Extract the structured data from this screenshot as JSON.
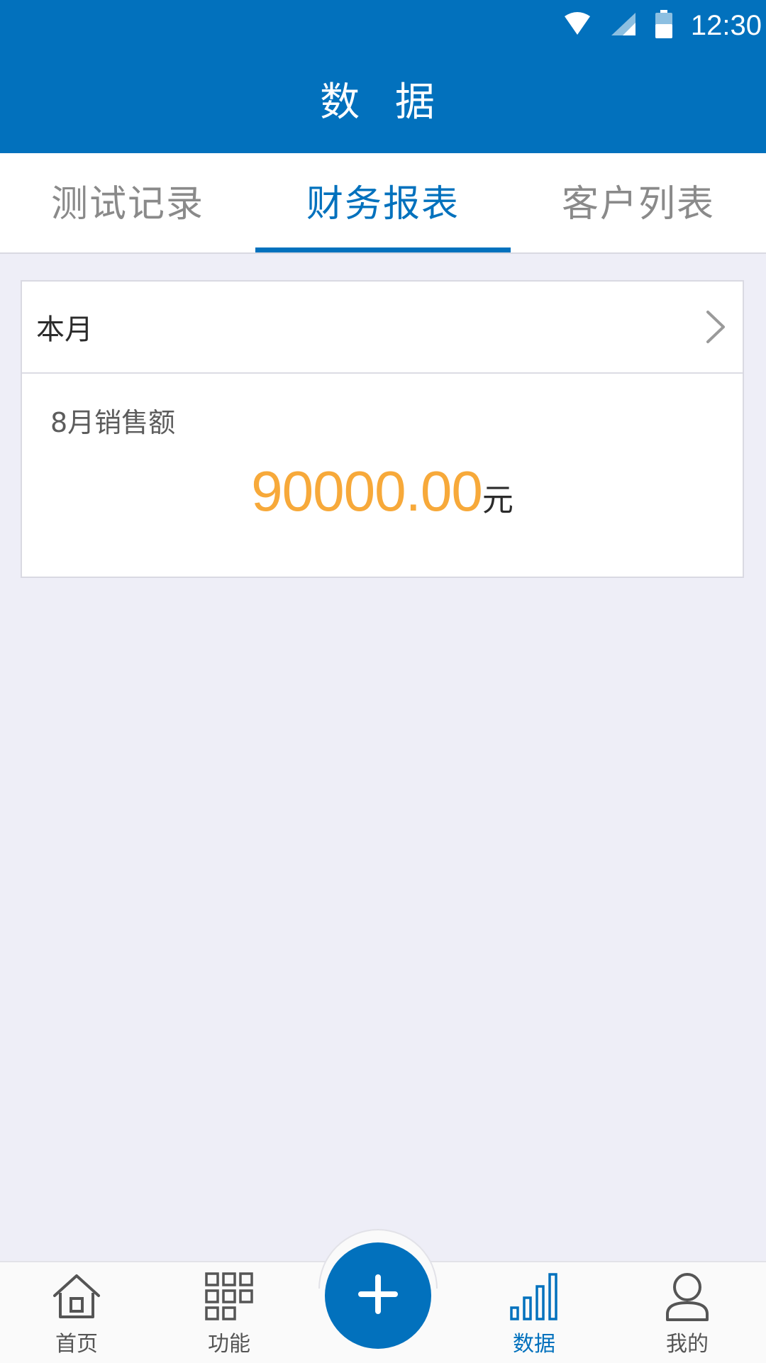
{
  "status_bar": {
    "time": "12:30",
    "icons": [
      "wifi-icon",
      "signal-icon",
      "battery-icon"
    ],
    "background": "#0271bd"
  },
  "header": {
    "title": "数 据"
  },
  "tabs": [
    {
      "label": "测试记录",
      "active": false
    },
    {
      "label": "财务报表",
      "active": true
    },
    {
      "label": "客户列表",
      "active": false
    }
  ],
  "card": {
    "period_label": "本月",
    "sales_label": "8月销售额",
    "sales_amount": "90000.00",
    "sales_unit": "元"
  },
  "bottom_nav": {
    "items": [
      {
        "label": "首页",
        "icon": "home-icon",
        "active": false
      },
      {
        "label": "功能",
        "icon": "grid-icon",
        "active": false
      },
      {
        "label": "数据",
        "icon": "bar-chart-icon",
        "active": true
      },
      {
        "label": "我的",
        "icon": "user-icon",
        "active": false
      }
    ],
    "fab_icon": "plus-icon"
  },
  "colors": {
    "primary": "#0271bd",
    "amount": "#f7a93a",
    "background": "#eeeef7"
  }
}
